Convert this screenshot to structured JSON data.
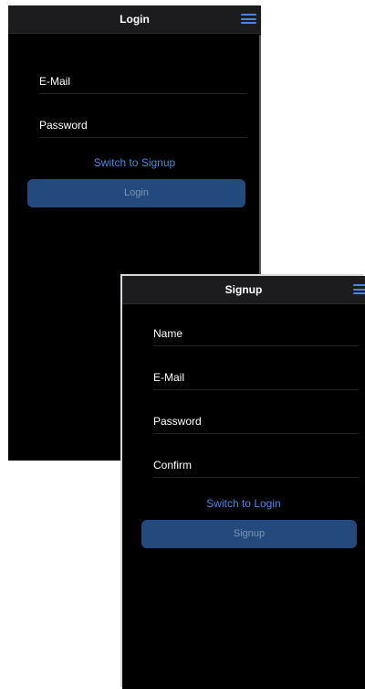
{
  "login": {
    "title": "Login",
    "email_placeholder": "E-Mail",
    "password_placeholder": "Password",
    "switch_label": "Switch to Signup",
    "submit_label": "Login"
  },
  "signup": {
    "title": "Signup",
    "name_placeholder": "Name",
    "email_placeholder": "E-Mail",
    "password_placeholder": "Password",
    "confirm_placeholder": "Confirm",
    "switch_label": "Switch to Login",
    "submit_label": "Signup"
  },
  "icons": {
    "menu": "hamburger-menu-icon"
  },
  "colors": {
    "background": "#000000",
    "navbar": "#1c1c1e",
    "accent": "#4a86e8",
    "button": "#244a7d",
    "button_text": "#7e93b3"
  }
}
